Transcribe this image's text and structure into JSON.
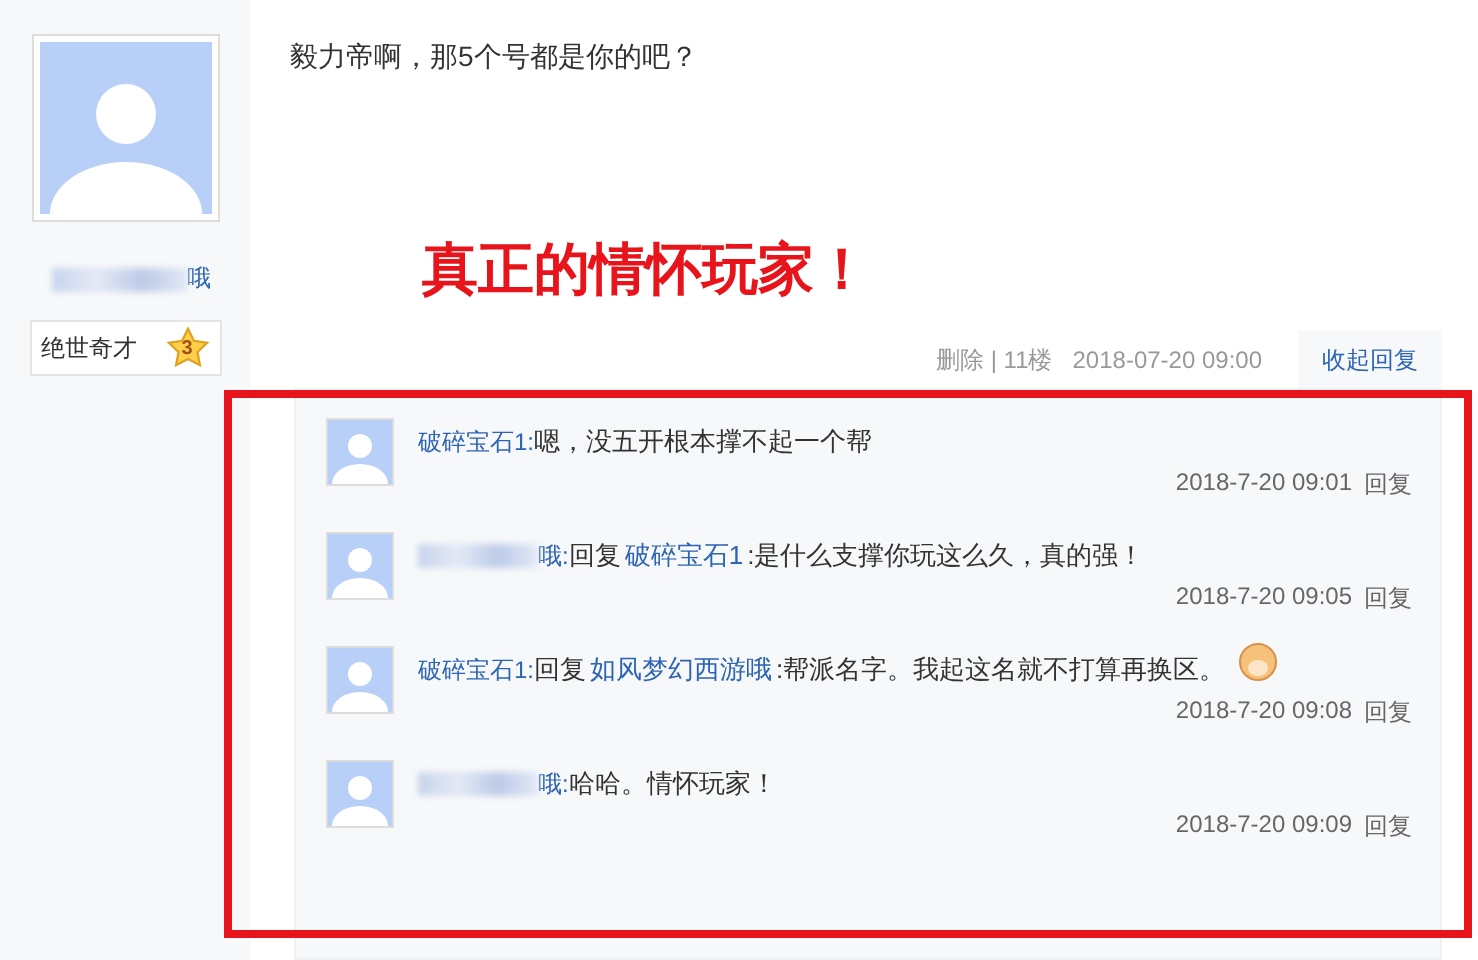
{
  "sidebar": {
    "username": "哦",
    "username_blurred": true,
    "badge": {
      "label": "绝世奇才",
      "level": "3"
    }
  },
  "post": {
    "text": "毅力帝啊，那5个号都是你的吧？",
    "annotation": "真正的情怀玩家！"
  },
  "meta": {
    "delete": "删除 | 11楼",
    "time": "2018-07-20 09:00",
    "toggle": "收起回复"
  },
  "replies": [
    {
      "author": "破碎宝石1:",
      "name_blurred": false,
      "text": "嗯，没五开根本撑不起一个帮",
      "emoticon": false,
      "time": "2018-7-20 09:01",
      "action": "回复"
    },
    {
      "author": "哦:",
      "name_blurred": true,
      "prefix": "回复",
      "reply_to": "破碎宝石1",
      "text": ":是什么支撑你玩这么久，真的强！",
      "emoticon": false,
      "time": "2018-7-20 09:05",
      "action": "回复"
    },
    {
      "author": "破碎宝石1:",
      "name_blurred": false,
      "prefix": "回复",
      "reply_to": "如风梦幻西游哦",
      "text": ":帮派名字。我起这名就不打算再换区。",
      "emoticon": true,
      "time": "2018-7-20 09:08",
      "action": "回复"
    },
    {
      "author": "哦:",
      "name_blurred": true,
      "text": "哈哈。情怀玩家！",
      "emoticon": false,
      "time": "2018-7-20 09:09",
      "action": "回复"
    }
  ]
}
